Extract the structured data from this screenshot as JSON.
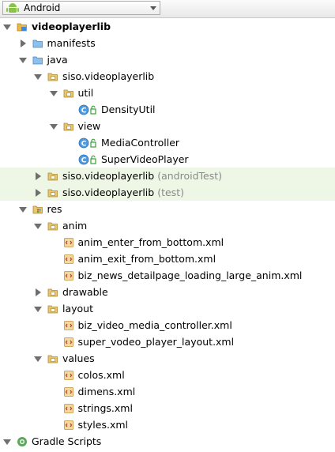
{
  "toolbar": {
    "view_selector_value": "Android"
  },
  "tree": [
    {
      "name": "module-videoplayerlib",
      "icon": "module-folder-icon",
      "state": "expanded",
      "depth": 0,
      "label": "videoplayerlib",
      "bold": true
    },
    {
      "name": "folder-manifests",
      "icon": "folder-icon",
      "state": "collapsed",
      "depth": 1,
      "label": "manifests"
    },
    {
      "name": "folder-java",
      "icon": "folder-icon",
      "state": "expanded",
      "depth": 1,
      "label": "java"
    },
    {
      "name": "package-siso-videoplayerlib",
      "icon": "package-icon",
      "state": "expanded",
      "depth": 2,
      "label": "siso.videoplayerlib"
    },
    {
      "name": "package-util",
      "icon": "package-icon",
      "state": "expanded",
      "depth": 3,
      "label": "util"
    },
    {
      "name": "class-densityutil",
      "icon": "class-icon",
      "state": "none",
      "depth": 4,
      "label": "DensityUtil"
    },
    {
      "name": "package-view",
      "icon": "package-icon",
      "state": "expanded",
      "depth": 3,
      "label": "view"
    },
    {
      "name": "class-mediacontroller",
      "icon": "class-icon",
      "state": "none",
      "depth": 4,
      "label": "MediaController"
    },
    {
      "name": "class-supervideoplayer",
      "icon": "class-icon",
      "state": "none",
      "depth": 4,
      "label": "SuperVideoPlayer"
    },
    {
      "name": "package-siso-videoplayerlib-androidtest",
      "icon": "package-icon",
      "state": "collapsed",
      "depth": 2,
      "label": "siso.videoplayerlib",
      "suffix": "(androidTest)",
      "highlight": true
    },
    {
      "name": "package-siso-videoplayerlib-test",
      "icon": "package-icon",
      "state": "collapsed",
      "depth": 2,
      "label": "siso.videoplayerlib",
      "suffix": "(test)",
      "highlight": true
    },
    {
      "name": "folder-res",
      "icon": "res-folder-icon",
      "state": "expanded",
      "depth": 1,
      "label": "res"
    },
    {
      "name": "folder-anim",
      "icon": "package-icon",
      "state": "expanded",
      "depth": 2,
      "label": "anim"
    },
    {
      "name": "file-anim-enter-from-bottom",
      "icon": "xml-file-icon",
      "state": "none",
      "depth": 3,
      "label": "anim_enter_from_bottom.xml"
    },
    {
      "name": "file-anim-exit-from-bottom",
      "icon": "xml-file-icon",
      "state": "none",
      "depth": 3,
      "label": "anim_exit_from_bottom.xml"
    },
    {
      "name": "file-biz-news-detailpage-loading",
      "icon": "xml-file-icon",
      "state": "none",
      "depth": 3,
      "label": "biz_news_detailpage_loading_large_anim.xml"
    },
    {
      "name": "folder-drawable",
      "icon": "package-icon",
      "state": "collapsed",
      "depth": 2,
      "label": "drawable"
    },
    {
      "name": "folder-layout",
      "icon": "package-icon",
      "state": "expanded",
      "depth": 2,
      "label": "layout"
    },
    {
      "name": "file-biz-video-media-controller",
      "icon": "xml-file-icon",
      "state": "none",
      "depth": 3,
      "label": "biz_video_media_controller.xml"
    },
    {
      "name": "file-super-vodeo-player-layout",
      "icon": "xml-file-icon",
      "state": "none",
      "depth": 3,
      "label": "super_vodeo_player_layout.xml"
    },
    {
      "name": "folder-values",
      "icon": "package-icon",
      "state": "expanded",
      "depth": 2,
      "label": "values"
    },
    {
      "name": "file-colos",
      "icon": "xml-file-icon",
      "state": "none",
      "depth": 3,
      "label": "colos.xml"
    },
    {
      "name": "file-dimens",
      "icon": "xml-file-icon",
      "state": "none",
      "depth": 3,
      "label": "dimens.xml"
    },
    {
      "name": "file-strings",
      "icon": "xml-file-icon",
      "state": "none",
      "depth": 3,
      "label": "strings.xml"
    },
    {
      "name": "file-styles",
      "icon": "xml-file-icon",
      "state": "none",
      "depth": 3,
      "label": "styles.xml"
    },
    {
      "name": "gradle-scripts",
      "icon": "gradle-icon",
      "state": "expanded",
      "depth": 0,
      "label": "Gradle Scripts"
    }
  ]
}
